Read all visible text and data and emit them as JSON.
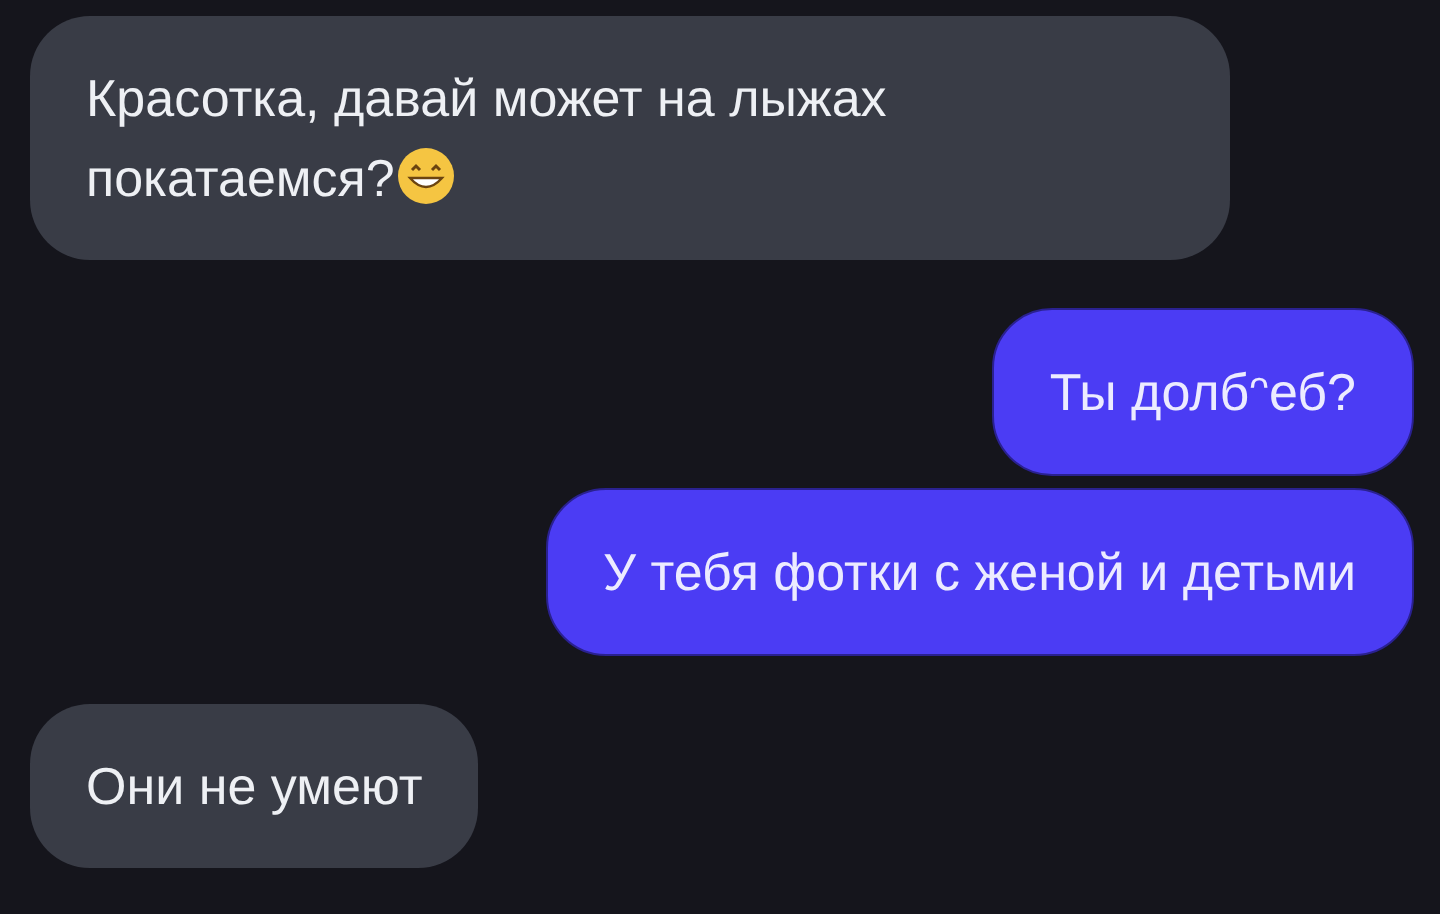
{
  "messages": [
    {
      "kind": "incoming",
      "text": "Красотка, давай может на лыжах покатаемся?",
      "trailing_emoji": true
    },
    {
      "kind": "outgoing",
      "text": "Ты долбᵔеб?",
      "trailing_emoji": false
    },
    {
      "kind": "outgoing",
      "text": "У тебя фотки с женой и детьми",
      "trailing_emoji": false
    },
    {
      "kind": "incoming",
      "text": "Они не умеют",
      "trailing_emoji": false
    }
  ]
}
